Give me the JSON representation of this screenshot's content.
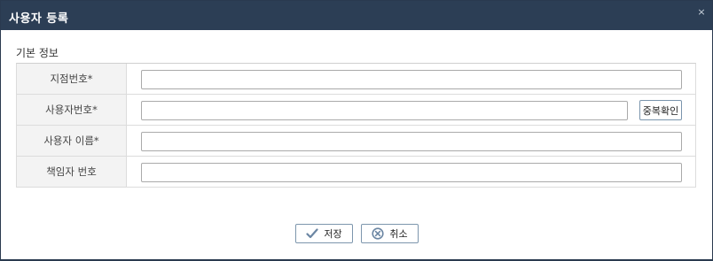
{
  "dialog": {
    "title": "사용자 등록",
    "close_icon": "×"
  },
  "section": {
    "title": "기본 정보"
  },
  "form": {
    "rows": [
      {
        "label": "지점번호*",
        "value": ""
      },
      {
        "label": "사용자번호*",
        "value": ""
      },
      {
        "label": "사용자 이름*",
        "value": ""
      },
      {
        "label": "책임자 번호",
        "value": ""
      }
    ],
    "duplicate_check_label": "중복확인"
  },
  "buttons": {
    "save_label": "저장",
    "save_icon": "check-icon",
    "cancel_label": "취소",
    "cancel_icon": "circle-x-icon"
  },
  "colors": {
    "titlebar": "#2c3e55",
    "button_border": "#7d96ad",
    "icon": "#6b86a3"
  }
}
